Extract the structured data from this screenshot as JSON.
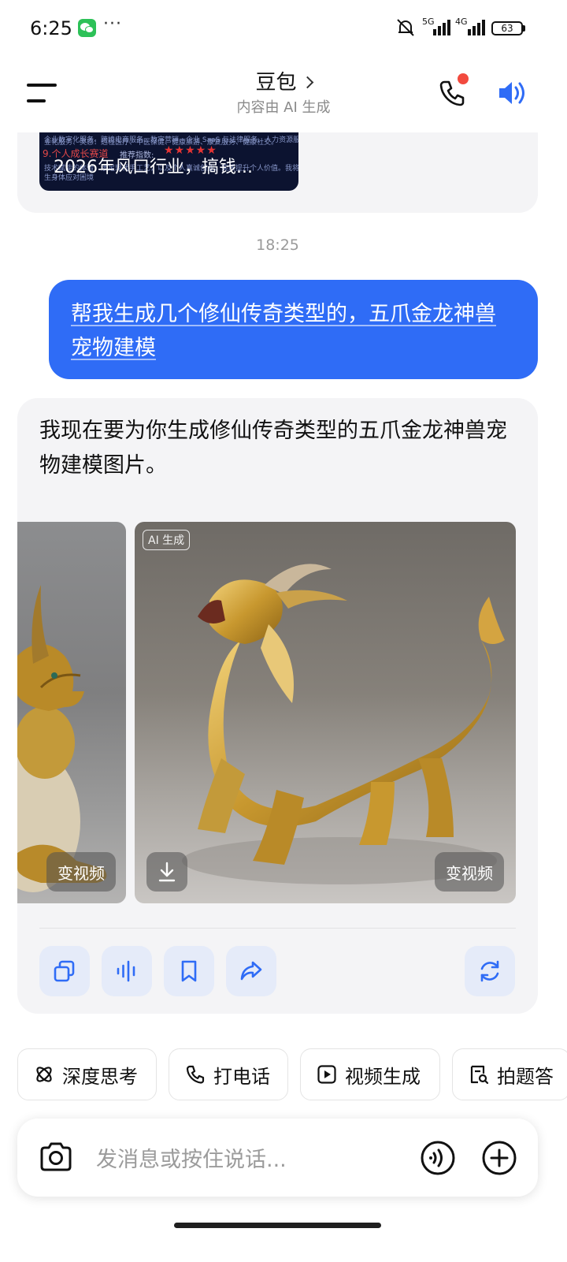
{
  "status_bar": {
    "time": "6:25",
    "dots": "···",
    "net1": "5G",
    "net2": "4G",
    "battery": "63"
  },
  "header": {
    "title": "豆包",
    "subtitle": "内容由 AI 生成"
  },
  "chat": {
    "previous_card": {
      "faint_line_1": "企业数字化服务、跨境电商服务、数字营销、企业 SaaS 与法律服务、人力资源服务、跨境电商、数字",
      "faint_line_2": "业化服务、灵感：远程医疗、中医保健、健康旅游、康复服务、健康社交。",
      "red_text": "9.个人成长赛道",
      "recommend_label": "推荐指数:",
      "stars": "★★★★★",
      "faint_line_3": "技术赋能的体验，涉足现代手工艺，以及个人真诚创业、实质提升个人价值。我将持续",
      "faint_line_4": "生身体应对困境",
      "caption": "2026年风口行业，搞钱..."
    },
    "timestamp": "18:25",
    "user_message": "帮我生成几个修仙传奇类型的，五爪金龙神兽宠物建模",
    "bot_message": "我现在要为你生成修仙传奇类型的五爪金龙神兽宠物建模图片。",
    "images": {
      "ai_tag": "AI 生成",
      "to_video_left": "变视频",
      "to_video_right": "变视频"
    }
  },
  "quick_actions": [
    {
      "label": "深度思考",
      "icon": "deep-think-icon"
    },
    {
      "label": "打电话",
      "icon": "phone-icon"
    },
    {
      "label": "视频生成",
      "icon": "video-play-icon"
    },
    {
      "label": "拍题答",
      "icon": "photo-question-icon"
    }
  ],
  "input": {
    "placeholder": "发消息或按住说话..."
  },
  "colors": {
    "accent": "#2f6cf6",
    "bubble_bg": "#f4f4f6",
    "action_bg": "#e5ebf9",
    "notify_dot": "#f24a3e"
  }
}
